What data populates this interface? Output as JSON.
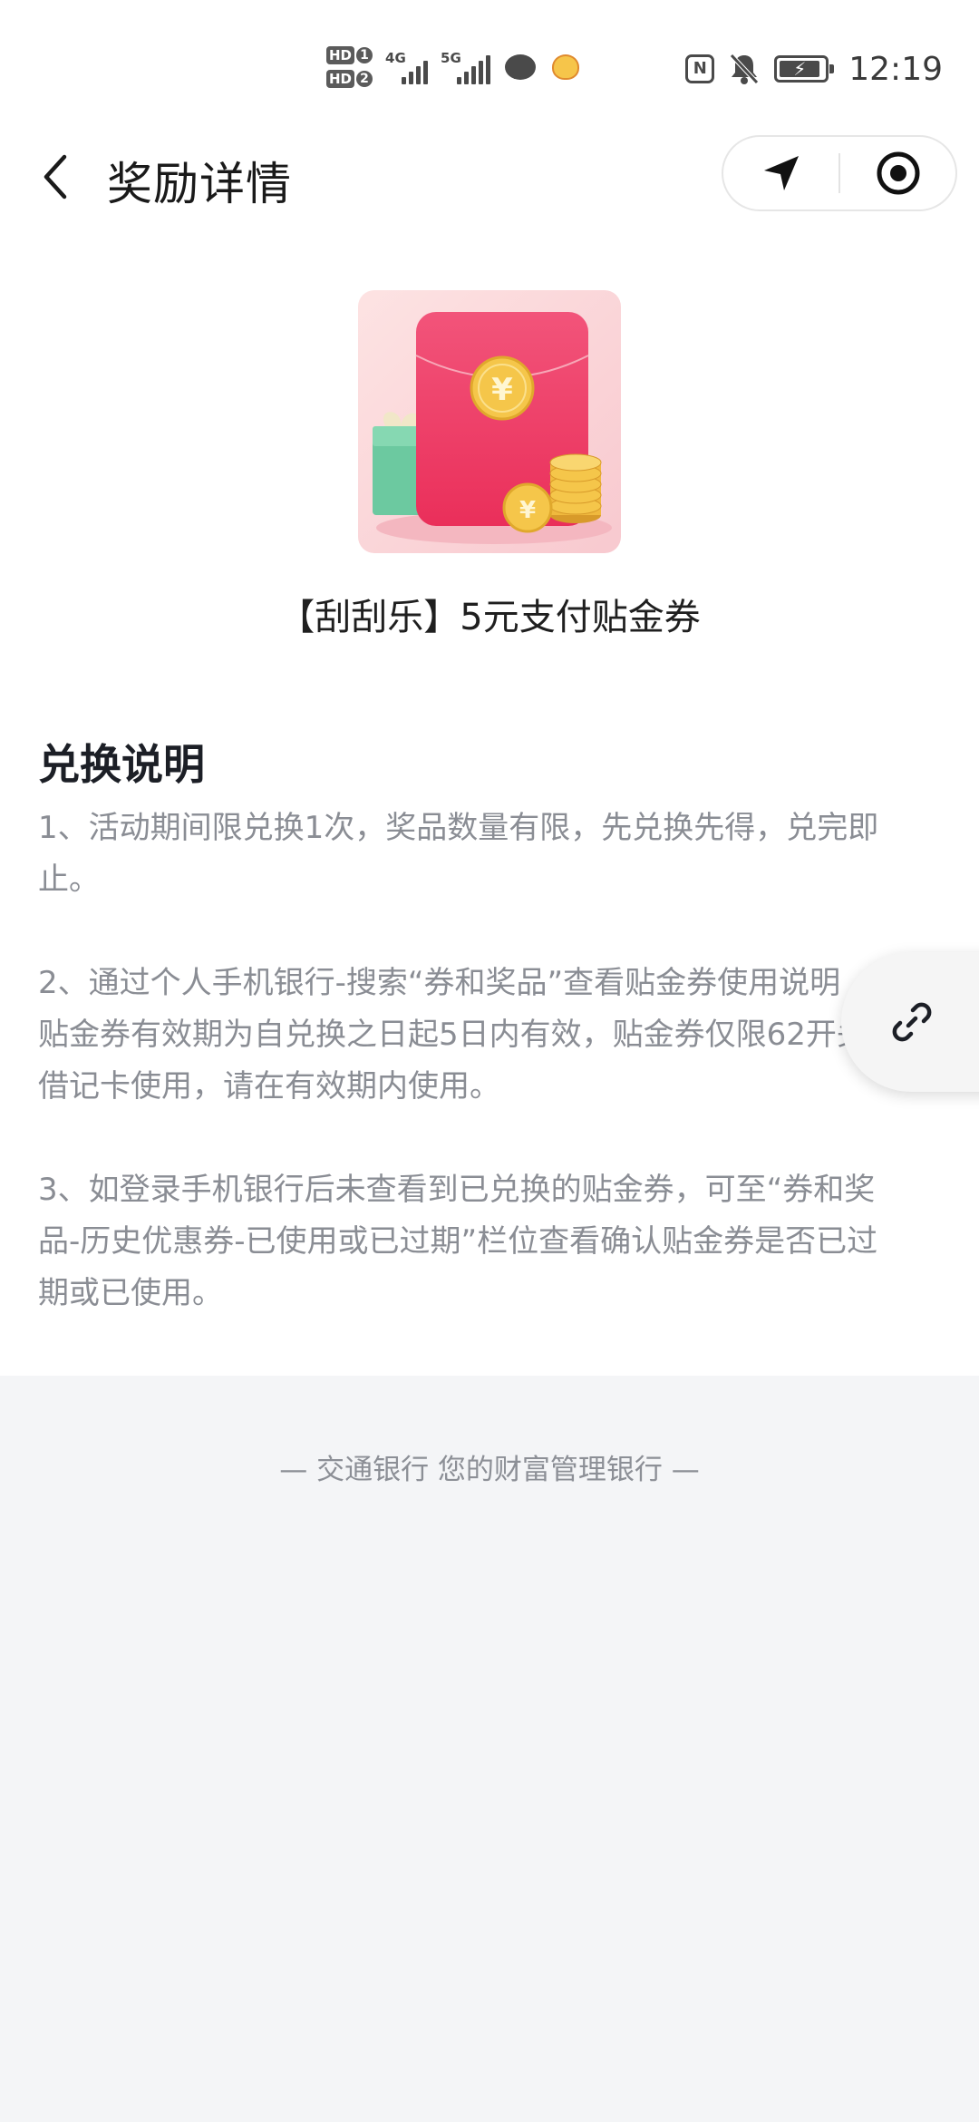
{
  "status_bar": {
    "sim1": "HD",
    "sim1_num": "1",
    "sim2": "HD",
    "sim2_num": "2",
    "net1": "4G",
    "net2": "5G",
    "time": "12:19",
    "nfc": "N",
    "icons": [
      "nfc-icon",
      "bell-off-icon",
      "battery-charging-icon",
      "chat-icon",
      "pet-icon"
    ]
  },
  "nav": {
    "title": "奖励详情",
    "back_icon": "chevron-left-icon",
    "capsule_icons": [
      "navigation-arrow-icon",
      "target-icon"
    ]
  },
  "prize": {
    "name": "【刮刮乐】5元支付贴金券",
    "coin_symbol": "¥",
    "colors": {
      "envelope": "#f0436b",
      "coin": "#f5c64a",
      "gift": "#6cc9a0",
      "bg": "#fbd7d9"
    }
  },
  "section": {
    "title": "兑换说明",
    "rules": [
      [
        "1、活动期间限兑换1次，奖品数量有限，先兑换先得，兑完即",
        "止。"
      ],
      [
        "2、通过个人手机银行-搜索“券和奖品”查看贴金券使用说明",
        "贴金券有效期为自兑换之日起5日内有效，贴金券仅限62开头",
        "借记卡使用，请在有效期内使用。"
      ],
      [
        "3、如登录手机银行后未查看到已兑换的贴金券，可至“券和奖",
        "品-历史优惠券-已使用或已过期”栏位查看确认贴金券是否已过",
        "期或已使用。"
      ]
    ]
  },
  "float_button": {
    "icon": "link-icon"
  },
  "footer": {
    "text": "— 交通银行 您的财富管理银行 —"
  }
}
